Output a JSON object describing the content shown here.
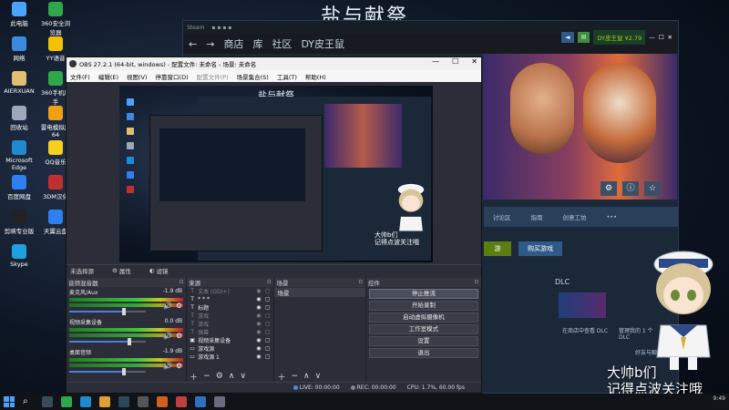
{
  "wallpaper": {
    "title": "盐与献祭"
  },
  "desktop": {
    "icons": [
      {
        "label": "此电脑",
        "color": "#4aa3ff"
      },
      {
        "label": "360安全浏览器",
        "color": "#2ea84a"
      },
      {
        "label": "网络",
        "color": "#3b8ae0"
      },
      {
        "label": "YY语音",
        "color": "#f2c200"
      },
      {
        "label": "AIERXUAN",
        "color": "#e0c070"
      },
      {
        "label": "360手机助手",
        "color": "#2ea84a"
      },
      {
        "label": "回收站",
        "color": "#9aa8b8"
      },
      {
        "label": "雷电模拟器64",
        "color": "#f0a010"
      },
      {
        "label": "Microsoft Edge",
        "color": "#1e8ad0"
      },
      {
        "label": "QQ音乐",
        "color": "#f5d020"
      },
      {
        "label": "百度网盘",
        "color": "#2f7ff0"
      },
      {
        "label": "3DM汉化",
        "color": "#c03030"
      },
      {
        "label": "剪映专业版",
        "color": "#222222"
      },
      {
        "label": "天翼云盘",
        "color": "#2f7ff0"
      },
      {
        "label": "Skype",
        "color": "#1fa0e0"
      }
    ]
  },
  "steam": {
    "top_label": "Steam",
    "nav": [
      "商店",
      "库",
      "社区",
      "DY皮王鼠"
    ],
    "user": "DY皮王鼠",
    "wallet": "¥2.79",
    "strip": [
      "讨论区",
      "指南",
      "创意工坊",
      "•••"
    ],
    "green_btn": "游",
    "blue_btn": "购买游戏",
    "dlc": {
      "label": "DLC",
      "left": "在商店中查看 DLC",
      "right": "管理我的 1 个 DLC"
    },
    "friends": "好友与聊天"
  },
  "caption": [
    "大帅b们",
    "记得点波关注哦"
  ],
  "obs": {
    "title": "OBS 27.2.1 (64-bit, windows) - 配置文件: 未命名 - 场景: 未命名",
    "menu": [
      "文件(F)",
      "编辑(E)",
      "视图(V)",
      "停靠窗口(D)",
      "配置文件(P)",
      "场景集合(S)",
      "工具(T)",
      "帮助(H)"
    ],
    "no_source": "未选择源",
    "props": "属性",
    "filters": "滤镜",
    "docks": {
      "mixer": "音频混音器",
      "sources": "来源",
      "scenes": "场景",
      "controls": "控件"
    },
    "mixer_channels": [
      {
        "name": "麦克风/Aux",
        "db": "-1.9 dB",
        "level": 0.72
      },
      {
        "name": "视频采集设备",
        "db": "0.0 dB",
        "level": 0.78
      },
      {
        "name": "桌面音频",
        "db": "-1.9 dB",
        "level": 0.72
      }
    ],
    "sources": [
      {
        "label": "文本 (GDI+)",
        "icon": "text-icon",
        "dim": true
      },
      {
        "label": "* * *",
        "icon": "text-icon",
        "dim": false
      },
      {
        "label": "标题",
        "icon": "text-icon",
        "dim": false
      },
      {
        "label": "游戏",
        "icon": "text-icon",
        "dim": true
      },
      {
        "label": "游戏",
        "icon": "text-icon",
        "dim": true
      },
      {
        "label": "弹幕",
        "icon": "text-icon",
        "dim": true
      },
      {
        "label": "视频采集设备",
        "icon": "camera-icon",
        "dim": false
      },
      {
        "label": "游戏源",
        "icon": "monitor-icon",
        "dim": false
      },
      {
        "label": "游戏源 1",
        "icon": "monitor-icon",
        "dim": false
      }
    ],
    "scenes": [
      "场景"
    ],
    "controls": [
      "停止推流",
      "开始录制",
      "启动虚拟摄像机",
      "工作室模式",
      "设置",
      "退出"
    ],
    "footer": {
      "live": "LIVE: 00:00:00",
      "rec": "REC: 00:00:00",
      "cpu": "CPU: 1.7%, 60.00 fps"
    },
    "preview_title": "盐与献祭"
  },
  "taskbar": {
    "tray": "9:49"
  }
}
